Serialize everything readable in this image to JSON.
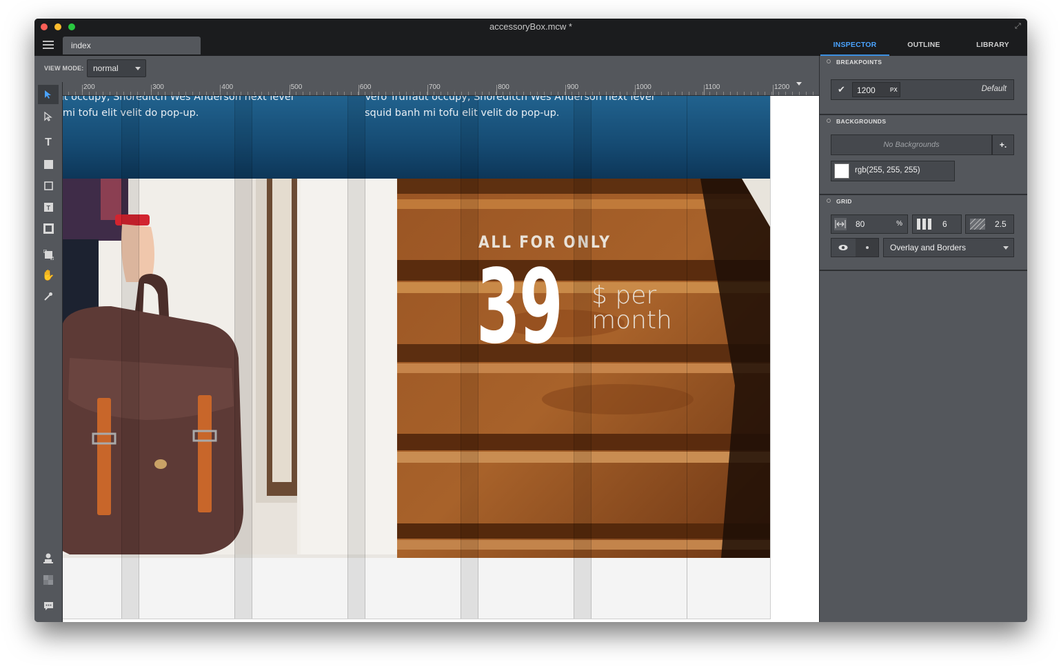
{
  "window": {
    "title": "accessoryBox.mcw *"
  },
  "document_tab": {
    "label": "index"
  },
  "panel_tabs": [
    {
      "label": "INSPECTOR",
      "active": true
    },
    {
      "label": "OUTLINE",
      "active": false
    },
    {
      "label": "LIBRARY",
      "active": false
    }
  ],
  "toolbar": {
    "view_mode_label": "VIEW MODE:",
    "view_mode_value": "normal"
  },
  "tools": [
    {
      "icon": "select-arrow-icon",
      "active": true
    },
    {
      "icon": "direct-select-icon"
    },
    {
      "icon": "text-tool-icon"
    },
    {
      "icon": "rectangle-fill-icon"
    },
    {
      "icon": "rectangle-outline-icon"
    },
    {
      "icon": "text-box-icon"
    },
    {
      "icon": "image-tool-icon"
    },
    {
      "icon": "crop-icon"
    },
    {
      "icon": "hand-icon"
    },
    {
      "icon": "eyedropper-icon"
    },
    {
      "icon": "user-stamp-icon"
    },
    {
      "icon": "checker-icon"
    },
    {
      "icon": "comment-icon"
    }
  ],
  "ruler": {
    "labels": [
      "200",
      "300",
      "400",
      "500",
      "600",
      "700",
      "800",
      "900",
      "1000",
      "1100",
      "1200"
    ]
  },
  "canvas": {
    "hero_text_left": "Vero Truffaut occupy, Shoreditch Wes Anderson next level squid banh mi tofu elit velit do pop-up.",
    "hero_text_right": "Vero Truffaut occupy, Shoreditch Wes Anderson next level squid banh mi tofu elit velit do pop-up.",
    "price_heading": "ALL FOR ONLY",
    "price_number": "39",
    "price_unit_line1": "$ per",
    "price_unit_line2": "month"
  },
  "inspector": {
    "breakpoints": {
      "title": "BREAKPOINTS",
      "value": "1200",
      "unit": "PX",
      "default_label": "Default"
    },
    "backgrounds": {
      "title": "BACKGROUNDS",
      "empty_label": "No Backgrounds",
      "add_label": "+.",
      "color_label": "rgb(255, 255, 255)"
    },
    "grid": {
      "title": "GRID",
      "width_value": "80",
      "width_unit": "%",
      "columns_value": "6",
      "gutter_value": "2.5",
      "display_mode": "Overlay and Borders"
    }
  },
  "colors": {
    "accent": "#3b8fe0",
    "hero_blue": "#1b5583",
    "panel": "#54575c",
    "titlebar": "#1b1c1e"
  }
}
